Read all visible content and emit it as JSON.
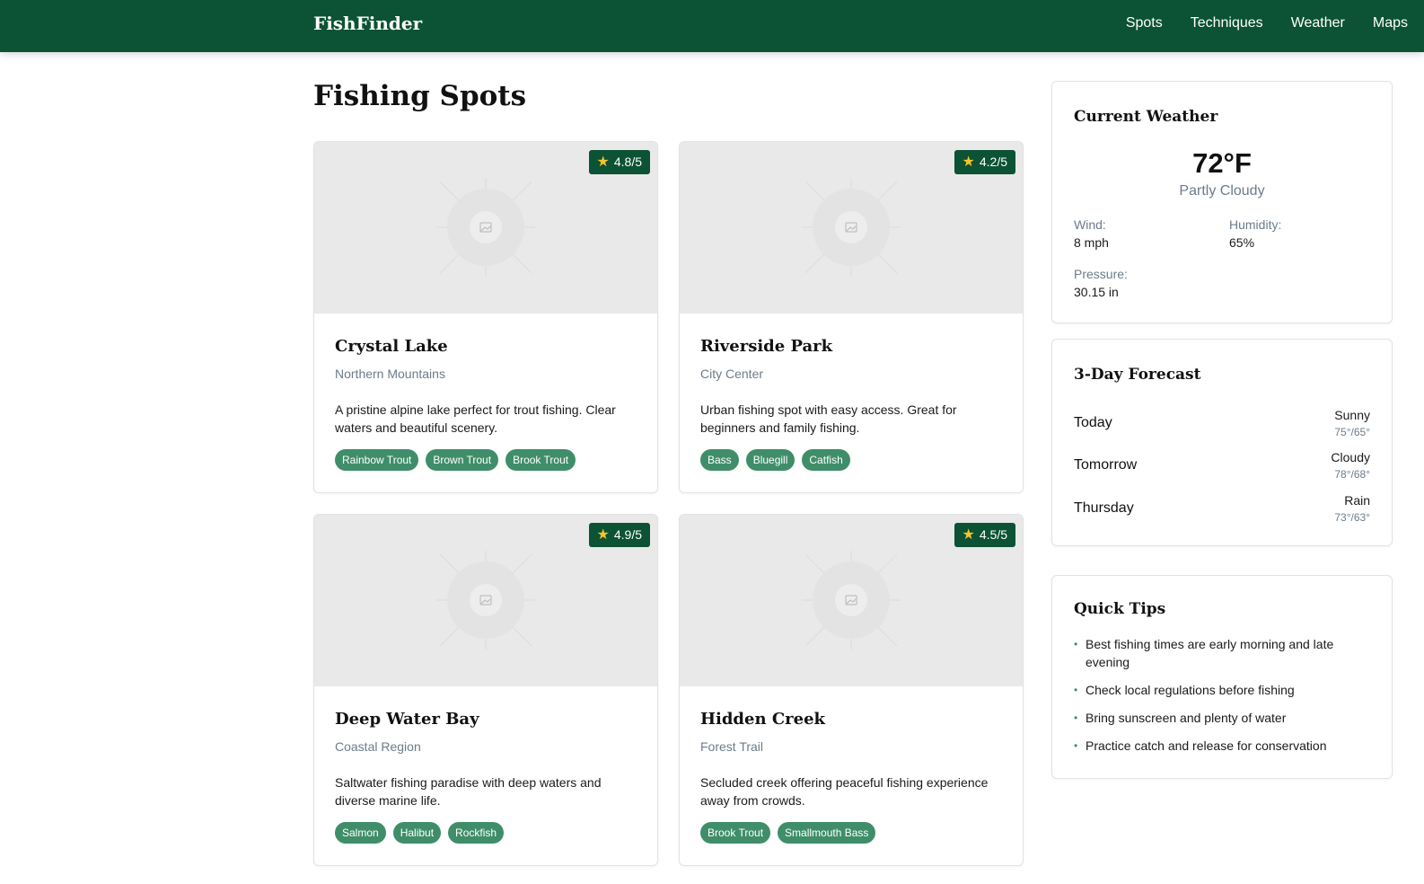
{
  "header": {
    "brand": "FishFinder",
    "nav": [
      "Spots",
      "Techniques",
      "Weather",
      "Maps"
    ]
  },
  "page": {
    "title": "Fishing Spots"
  },
  "spots": [
    {
      "name": "Crystal Lake",
      "region": "Northern Mountains",
      "rating": "4.8/5",
      "description": "A pristine alpine lake perfect for trout fishing. Clear waters and beautiful scenery.",
      "tags": [
        "Rainbow Trout",
        "Brown Trout",
        "Brook Trout"
      ]
    },
    {
      "name": "Riverside Park",
      "region": "City Center",
      "rating": "4.2/5",
      "description": "Urban fishing spot with easy access. Great for beginners and family fishing.",
      "tags": [
        "Bass",
        "Bluegill",
        "Catfish"
      ]
    },
    {
      "name": "Deep Water Bay",
      "region": "Coastal Region",
      "rating": "4.9/5",
      "description": "Saltwater fishing paradise with deep waters and diverse marine life.",
      "tags": [
        "Salmon",
        "Halibut",
        "Rockfish"
      ]
    },
    {
      "name": "Hidden Creek",
      "region": "Forest Trail",
      "rating": "4.5/5",
      "description": "Secluded creek offering peaceful fishing experience away from crowds.",
      "tags": [
        "Brook Trout",
        "Smallmouth Bass"
      ]
    }
  ],
  "weather": {
    "title": "Current Weather",
    "temp": "72°F",
    "condition": "Partly Cloudy",
    "wind_label": "Wind:",
    "wind": "8 mph",
    "humidity_label": "Humidity:",
    "humidity": "65%",
    "pressure_label": "Pressure:",
    "pressure": "30.15 in"
  },
  "forecast": {
    "title": "3-Day Forecast",
    "days": [
      {
        "day": "Today",
        "condition": "Sunny",
        "temps": "75°/65°"
      },
      {
        "day": "Tomorrow",
        "condition": "Cloudy",
        "temps": "78°/68°"
      },
      {
        "day": "Thursday",
        "condition": "Rain",
        "temps": "73°/63°"
      }
    ]
  },
  "tips": {
    "title": "Quick Tips",
    "items": [
      "Best fishing times are early morning and late evening",
      "Check local regulations before fishing",
      "Bring sunscreen and plenty of water",
      "Practice catch and release for conservation"
    ]
  },
  "icons": {
    "rating": "star-icon",
    "image_placeholder": "image-placeholder-icon",
    "tip_bullet": "bullet-dot"
  },
  "colors": {
    "header_bg": "#0c5234",
    "tag_bg": "#3f8e69",
    "star": "#f5c42c",
    "muted": "#6b7c8c"
  }
}
